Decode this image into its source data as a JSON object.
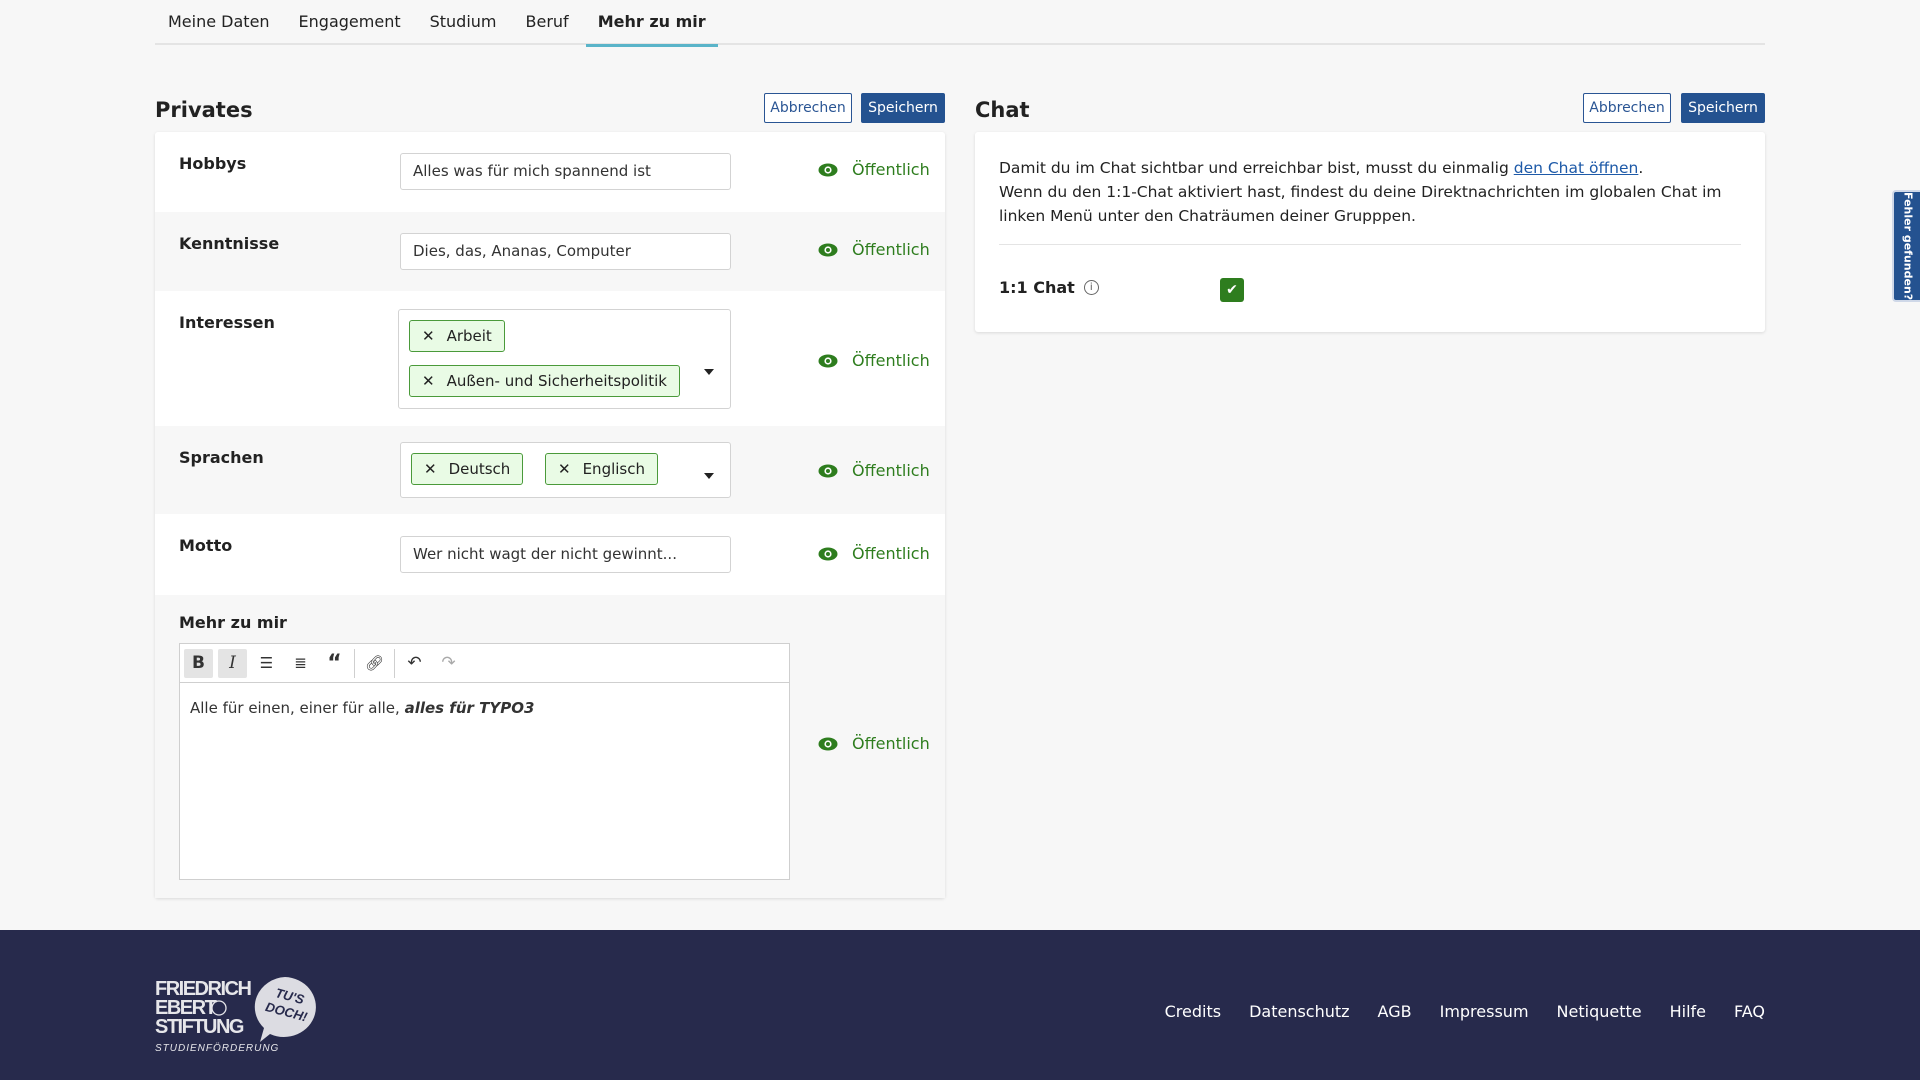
{
  "tabs": [
    {
      "label": "Meine Daten"
    },
    {
      "label": "Engagement"
    },
    {
      "label": "Studium"
    },
    {
      "label": "Beruf"
    },
    {
      "label": "Mehr zu mir",
      "active": true
    }
  ],
  "privates": {
    "title": "Privates",
    "cancel": "Abbrechen",
    "save": "Speichern",
    "visibility": "Öffentlich",
    "hobbys": {
      "label": "Hobbys",
      "value": "Alles was für mich spannend ist"
    },
    "kenntnisse": {
      "label": "Kenntnisse",
      "value": "Dies, das, Ananas, Computer"
    },
    "interessen": {
      "label": "Interessen",
      "tags": [
        "Arbeit",
        "Außen- und Sicherheitspolitik"
      ]
    },
    "sprachen": {
      "label": "Sprachen",
      "tags": [
        "Deutsch",
        "Englisch"
      ]
    },
    "motto": {
      "label": "Motto",
      "value": "Wer nicht wagt der nicht gewinnt..."
    },
    "mehr": {
      "label": "Mehr zu mir",
      "text_plain": "Alle für einen, einer für alle, ",
      "text_bold_italic": "alles für TYPO3",
      "toolbar": [
        "bold",
        "italic",
        "bulleted-list",
        "numbered-list",
        "blockquote",
        "link",
        "undo",
        "redo"
      ]
    }
  },
  "chat": {
    "title": "Chat",
    "cancel": "Abbrechen",
    "save": "Speichern",
    "text1": "Damit du im Chat sichtbar und erreichbar bist, musst du einmalig ",
    "link": "den Chat öffnen",
    "text1_end": ".",
    "text2": "Wenn du den 1:1-Chat aktiviert hast, findest du deine Direktnachrichten im globalen Chat im linken Menü unter den Chaträumen deiner Grupppen.",
    "one_to_one_label": "1:1 Chat",
    "one_to_one_checked": true
  },
  "side_tab": "Fehler gefunden?",
  "footer": {
    "logo": "FRIEDRICH EBERT STIFTUNG STUDIENFÖRDERUNG TU'S DOCH!",
    "links": [
      "Credits",
      "Datenschutz",
      "AGB",
      "Impressum",
      "Netiquette",
      "Hilfe",
      "FAQ"
    ]
  },
  "colors": {
    "primary": "#245290",
    "accent": "#5ab4c9",
    "public": "#2e7d1e",
    "footer": "#272a4c",
    "tag_bg": "#e9fbe5"
  }
}
